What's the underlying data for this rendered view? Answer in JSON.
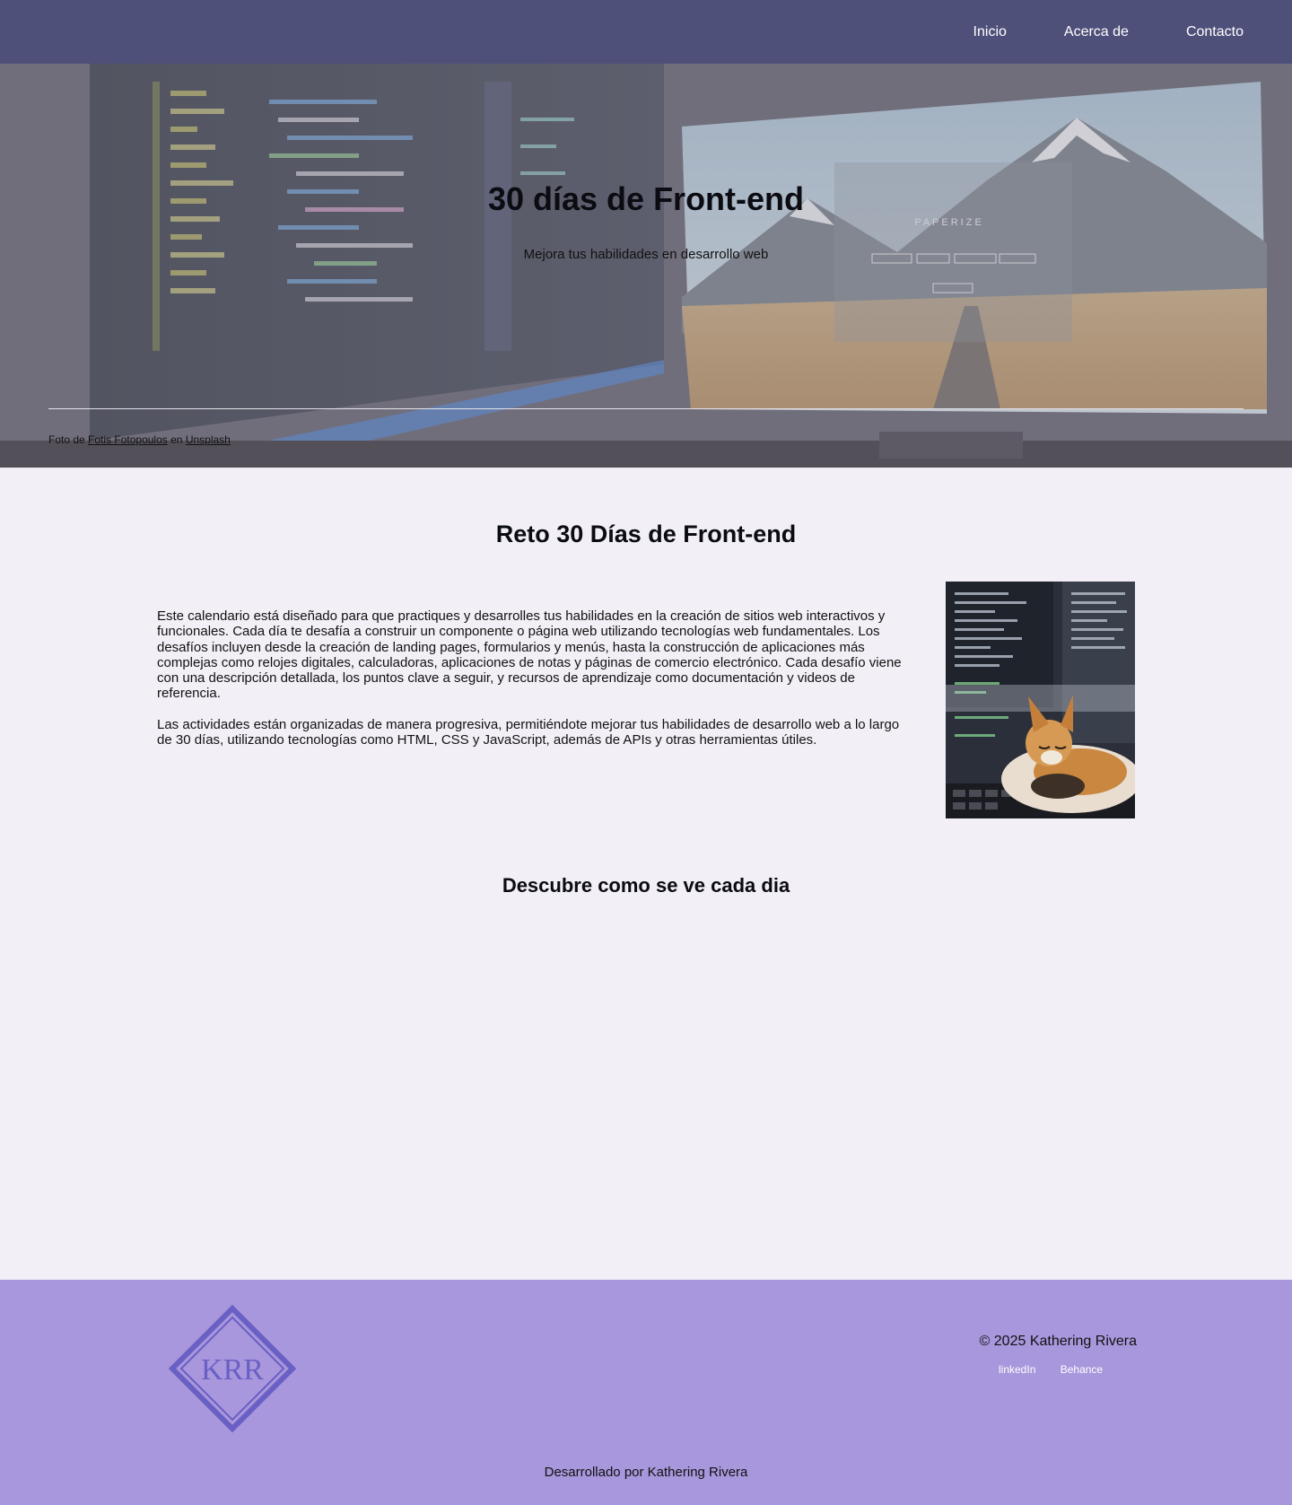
{
  "nav": {
    "items": [
      {
        "label": "Inicio"
      },
      {
        "label": "Acerca de"
      },
      {
        "label": "Contacto"
      }
    ]
  },
  "hero": {
    "title": "30 días de Front-end",
    "subtitle": "Mejora tus habilidades en desarrollo web",
    "photo_text": "PAPERIZE",
    "credit": {
      "prefix": "Foto de",
      "author": "Fotis Fotopoulos",
      "middle": "en",
      "site": "Unsplash"
    }
  },
  "main": {
    "title": "Reto 30 Días de Front-end",
    "paragraphs": [
      "Este calendario está diseñado para que practiques y desarrolles tus habilidades en la creación de sitios web interactivos y funcionales. Cada día te desafía a construir un componente o página web utilizando tecnologías web fundamentales. Los desafíos incluyen desde la creación de landing pages, formularios y menús, hasta la construcción de aplicaciones más complejas como relojes digitales, calculadoras, aplicaciones de notas y páginas de comercio electrónico. Cada desafío viene con una descripción detallada, los puntos clave a seguir, y recursos de aprendizaje como documentación y videos de referencia.",
      "Las actividades están organizadas de manera progresiva, permitiéndote mejorar tus habilidades de desarrollo web a lo largo de 30 días, utilizando tecnologías como HTML, CSS y JavaScript, además de APIs y otras herramientas útiles."
    ],
    "section2_title": "Descubre como se ve cada dia"
  },
  "footer": {
    "logo_text": "KRR",
    "copyright": "© 2025 Kathering Rivera",
    "links": [
      {
        "label": "linkedIn"
      },
      {
        "label": "Behance"
      }
    ],
    "developed_by": "Desarrollado por Kathering Rivera"
  },
  "colors": {
    "nav_bg": "#4f507a",
    "page_bg": "#f2eff6",
    "footer_bg": "#a897dc",
    "logo": "#6a5fc4"
  }
}
